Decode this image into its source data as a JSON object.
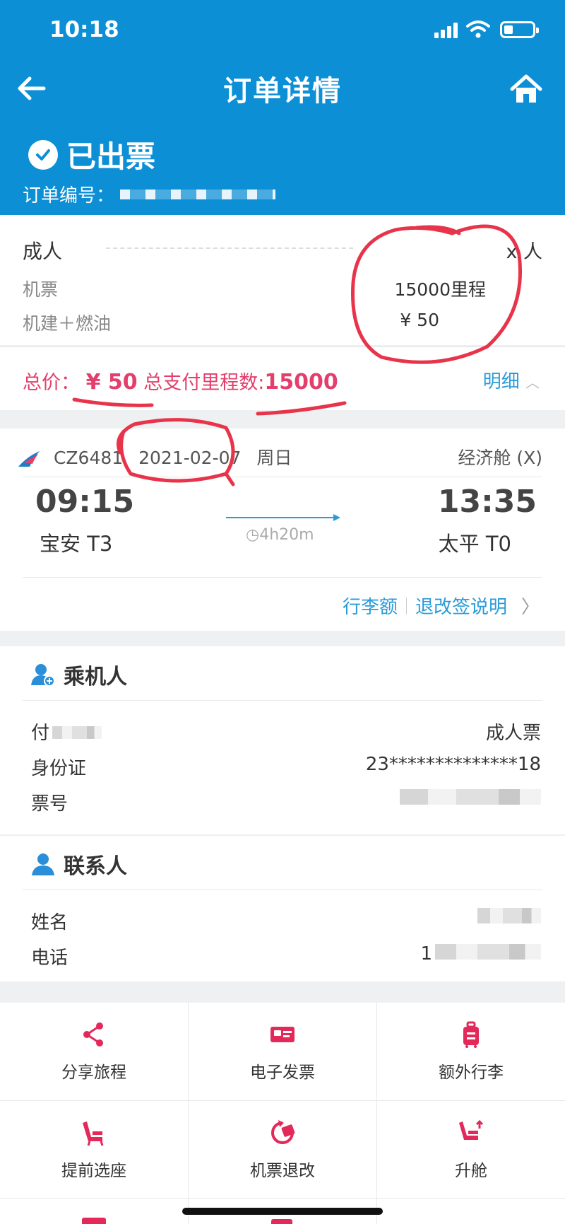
{
  "status_bar": {
    "time": "10:18"
  },
  "nav": {
    "title": "订单详情"
  },
  "order": {
    "status": "已出票",
    "order_no_label": "订单编号："
  },
  "fare": {
    "passenger_type": "成人",
    "count": "x 人",
    "ticket_label": "机票",
    "ticket_value": "15000里程",
    "tax_label": "机建＋燃油",
    "tax_value": "¥ 50"
  },
  "total": {
    "label": "总价：",
    "amount": "¥ 50",
    "miles_label": "总支付里程数:",
    "miles": "15000",
    "detail": "明细"
  },
  "flight": {
    "flight_no": "CZ6481",
    "date": "2021-02-07",
    "weekday": "周日",
    "cabin": "经济舱 (X)",
    "dep_time": "09:15",
    "arr_time": "13:35",
    "dep_airport": "宝安 T3",
    "arr_airport": "太平 T0",
    "duration": "4h20m",
    "baggage": "行李额",
    "rules": "退改签说明"
  },
  "passenger": {
    "section_title": "乘机人",
    "name": "付",
    "ticket_type": "成人票",
    "id_label": "身份证",
    "id_value": "23**************18",
    "ticket_no_label": "票号"
  },
  "contact": {
    "section_title": "联系人",
    "name_label": "姓名",
    "phone_label": "电话",
    "phone_prefix": "1"
  },
  "actions": [
    {
      "label": "分享旅程",
      "icon": "share-icon"
    },
    {
      "label": "电子发票",
      "icon": "invoice-icon"
    },
    {
      "label": "额外行李",
      "icon": "luggage-icon"
    },
    {
      "label": "提前选座",
      "icon": "seat-icon"
    },
    {
      "label": "机票退改",
      "icon": "refund-icon"
    },
    {
      "label": "升舱",
      "icon": "upgrade-icon"
    }
  ],
  "colors": {
    "header": "#0d8fd6",
    "accent_pink": "#e33e6c",
    "link_blue": "#2a9bd8",
    "annotation_red": "#e8344a"
  }
}
